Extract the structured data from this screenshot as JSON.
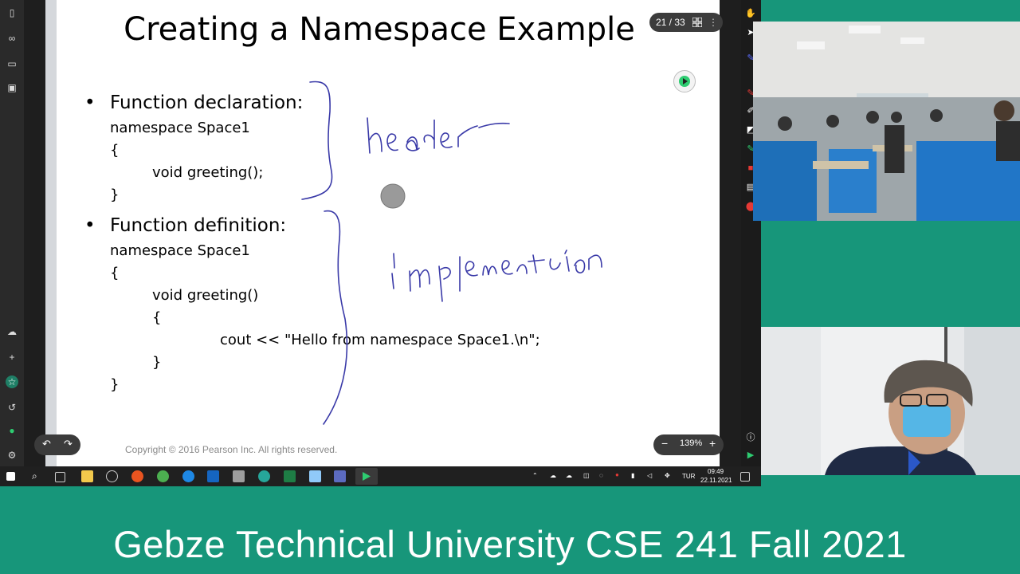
{
  "slide": {
    "title": "Creating a Namespace Example",
    "bullet1_heading": "Function declaration:",
    "bullet1_code": [
      "namespace Space1",
      "{",
      "void greeting();",
      "}"
    ],
    "bullet2_heading": "Function definition:",
    "bullet2_code": [
      "namespace Space1",
      "{",
      "void greeting()",
      "{",
      "cout << \"Hello from namespace Space1.\\n\";",
      "}",
      "}"
    ],
    "copyright": "Copyright © 2016 Pearson Inc. All rights reserved."
  },
  "viewer": {
    "page_indicator": "21 / 33",
    "zoom": "139%"
  },
  "taskbar": {
    "language": "TUR",
    "time": "09:49",
    "date": "22.11.2021"
  },
  "caption": "Gebze Technical University CSE 241 Fall 2021",
  "colors": {
    "background": "#17967a",
    "ink": "#3a3aa8"
  }
}
